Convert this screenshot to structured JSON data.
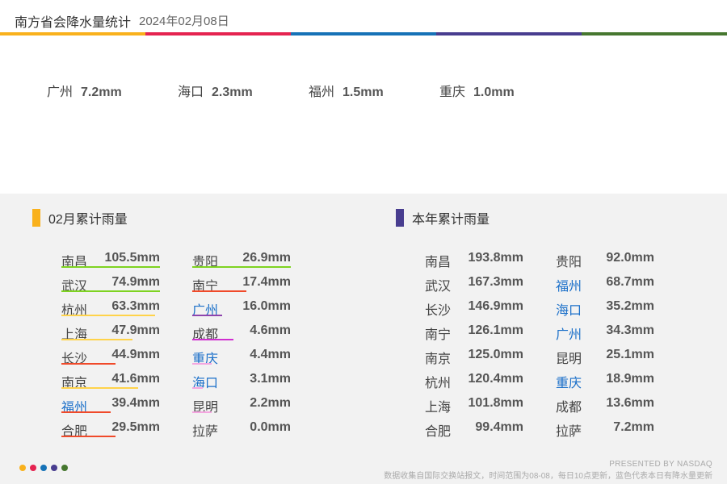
{
  "header": {
    "title": "南方省会降水量统计",
    "date": "2024年02月08日"
  },
  "palette": [
    "#f9b11c",
    "#e52350",
    "#1672b7",
    "#483d8f",
    "#46772f"
  ],
  "today": [
    {
      "city": "广州",
      "value": "7.2mm"
    },
    {
      "city": "海口",
      "value": "2.3mm"
    },
    {
      "city": "福州",
      "value": "1.5mm"
    },
    {
      "city": "重庆",
      "value": "1.0mm"
    }
  ],
  "monthly": {
    "title": "02月累计雨量",
    "marker_color": "#f9b11c",
    "col1": [
      {
        "city": "南昌",
        "value": "105.5mm",
        "blue": false,
        "line_color": "#7ed321",
        "line_fraction": 1.0
      },
      {
        "city": "武汉",
        "value": "74.9mm",
        "blue": false,
        "line_color": "#7ed321",
        "line_fraction": 1.0
      },
      {
        "city": "杭州",
        "value": "63.3mm",
        "blue": false,
        "line_color": "#ffd34a",
        "line_fraction": 0.95
      },
      {
        "city": "上海",
        "value": "47.9mm",
        "blue": false,
        "line_color": "#ffd34a",
        "line_fraction": 0.72
      },
      {
        "city": "长沙",
        "value": "44.9mm",
        "blue": false,
        "line_color": "#f04a2a",
        "line_fraction": 0.55
      },
      {
        "city": "南京",
        "value": "41.6mm",
        "blue": false,
        "line_color": "#ffd34a",
        "line_fraction": 0.78
      },
      {
        "city": "福州",
        "value": "39.4mm",
        "blue": true,
        "line_color": "#f04a2a",
        "line_fraction": 0.5
      },
      {
        "city": "合肥",
        "value": "29.5mm",
        "blue": false,
        "line_color": "#f04a2a",
        "line_fraction": 0.55
      }
    ],
    "col2": [
      {
        "city": "贵阳",
        "value": "26.9mm",
        "blue": false,
        "line_color": "#7ed321",
        "line_fraction": 1.0
      },
      {
        "city": "南宁",
        "value": "17.4mm",
        "blue": false,
        "line_color": "#f04a2a",
        "line_fraction": 0.55
      },
      {
        "city": "广州",
        "value": "16.0mm",
        "blue": true,
        "line_color": "#8e44ad",
        "line_fraction": 0.3
      },
      {
        "city": "成都",
        "value": "4.6mm",
        "blue": false,
        "line_color": "#d02ed0",
        "line_fraction": 0.42
      },
      {
        "city": "重庆",
        "value": "4.4mm",
        "blue": true,
        "line_color": "#f4a6e0",
        "line_fraction": 0.2
      },
      {
        "city": "海口",
        "value": "3.1mm",
        "blue": true,
        "line_color": "#f4a6e0",
        "line_fraction": 0.11
      },
      {
        "city": "昆明",
        "value": "2.2mm",
        "blue": false,
        "line_color": "#f4a6e0",
        "line_fraction": 0.2
      },
      {
        "city": "拉萨",
        "value": "0.0mm",
        "blue": false,
        "line_color": "",
        "line_fraction": 0
      }
    ]
  },
  "yearly": {
    "title": "本年累计雨量",
    "marker_color": "#483d8f",
    "col1": [
      {
        "city": "南昌",
        "value": "193.8mm",
        "blue": false
      },
      {
        "city": "武汉",
        "value": "167.3mm",
        "blue": false
      },
      {
        "city": "长沙",
        "value": "146.9mm",
        "blue": false
      },
      {
        "city": "南宁",
        "value": "126.1mm",
        "blue": false
      },
      {
        "city": "南京",
        "value": "125.0mm",
        "blue": false
      },
      {
        "city": "杭州",
        "value": "120.4mm",
        "blue": false
      },
      {
        "city": "上海",
        "value": "101.8mm",
        "blue": false
      },
      {
        "city": "合肥",
        "value": "99.4mm",
        "blue": false
      }
    ],
    "col2": [
      {
        "city": "贵阳",
        "value": "92.0mm",
        "blue": false
      },
      {
        "city": "福州",
        "value": "68.7mm",
        "blue": true
      },
      {
        "city": "海口",
        "value": "35.2mm",
        "blue": true
      },
      {
        "city": "广州",
        "value": "34.3mm",
        "blue": true
      },
      {
        "city": "昆明",
        "value": "25.1mm",
        "blue": false
      },
      {
        "city": "重庆",
        "value": "18.9mm",
        "blue": true
      },
      {
        "city": "成都",
        "value": "13.6mm",
        "blue": false
      },
      {
        "city": "拉萨",
        "value": "7.2mm",
        "blue": false
      }
    ]
  },
  "footer": {
    "credit": "PRESENTED BY NASDAQ",
    "note": "数据收集自国际交换站报文，时间范围为08-08，每日10点更新，蓝色代表本日有降水量更新"
  }
}
